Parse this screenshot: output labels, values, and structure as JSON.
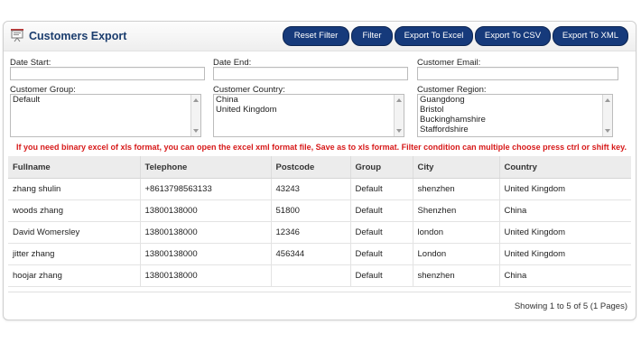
{
  "title": "Customers Export",
  "buttons": {
    "reset_filter": "Reset Filter",
    "filter": "Filter",
    "export_excel": "Export To Excel",
    "export_csv": "Export To CSV",
    "export_xml": "Export To XML"
  },
  "filters": {
    "date_start": {
      "label": "Date Start:",
      "value": ""
    },
    "date_end": {
      "label": "Date End:",
      "value": ""
    },
    "customer_email": {
      "label": "Customer Email:",
      "value": ""
    },
    "customer_group": {
      "label": "Customer Group:",
      "options": [
        "Default"
      ]
    },
    "customer_country": {
      "label": "Customer Country:",
      "options": [
        "China",
        "United Kingdom"
      ]
    },
    "customer_region": {
      "label": "Customer Region:",
      "options": [
        "Guangdong",
        "Bristol",
        "Buckinghamshire",
        "Staffordshire"
      ]
    }
  },
  "warning": "If you need binary excel of xls format, you can open the excel xml format file, Save as to xls format. Filter condition can multiple choose press ctrl or shift key.",
  "table": {
    "headers": [
      "Fullname",
      "Telephone",
      "Postcode",
      "Group",
      "City",
      "Country"
    ],
    "rows": [
      [
        "zhang shulin",
        "+8613798563133",
        "43243",
        "Default",
        "shenzhen",
        "United Kingdom"
      ],
      [
        "woods zhang",
        "13800138000",
        "51800",
        "Default",
        "Shenzhen",
        "China"
      ],
      [
        "David Womersley",
        "13800138000",
        "12346",
        "Default",
        "london",
        "United Kingdom"
      ],
      [
        "jitter zhang",
        "13800138000",
        "456344",
        "Default",
        "London",
        "United Kingdom"
      ],
      [
        "hoojar zhang",
        "13800138000",
        "",
        "Default",
        "shenzhen",
        "China"
      ]
    ]
  },
  "pagination": "Showing 1 to 5 of 5 (1 Pages)",
  "colors": {
    "button": "#163a7b",
    "title": "#1b3d6e",
    "warning": "#d71a1a"
  },
  "icons": {
    "title": "presentation-board-icon"
  }
}
